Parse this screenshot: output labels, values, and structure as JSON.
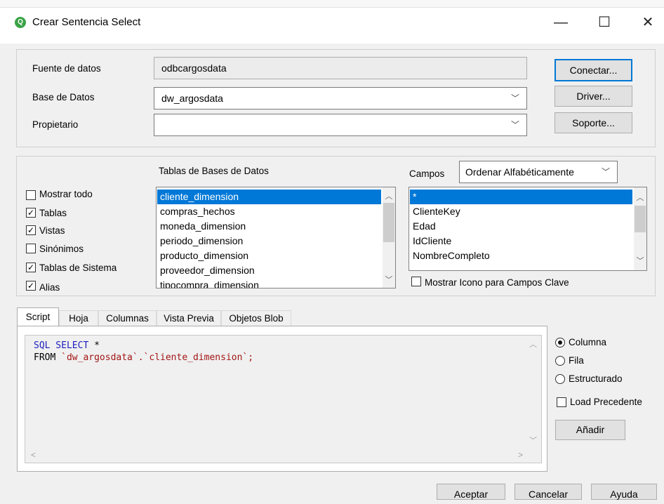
{
  "window": {
    "title": "Crear Sentencia Select",
    "app_badge": "Q",
    "min": "—",
    "max": "☐",
    "close": "✕"
  },
  "connection": {
    "fuente_label": "Fuente de datos",
    "fuente_value": "odbcargosdata",
    "base_label": "Base de Datos",
    "base_value": "dw_argosdata",
    "propietario_label": "Propietario",
    "propietario_value": "",
    "conectar": "Conectar...",
    "driver": "Driver...",
    "soporte": "Soporte..."
  },
  "options": {
    "mostrar_todo": "Mostrar todo",
    "tablas": "Tablas",
    "vistas": "Vistas",
    "sinonimos": "Sinónimos",
    "tablas_sistema": "Tablas de Sistema",
    "alias": "Alias",
    "checked": {
      "mostrar_todo": false,
      "tablas": true,
      "vistas": true,
      "sinonimos": false,
      "tablas_sistema": true,
      "alias": true
    }
  },
  "tables": {
    "header": "Tablas de Bases de Datos",
    "items": [
      "cliente_dimension",
      "compras_hechos",
      "moneda_dimension",
      "periodo_dimension",
      "producto_dimension",
      "proveedor_dimension",
      "tipocompra_dimension"
    ],
    "selected": 0
  },
  "fields": {
    "header": "Campos",
    "sort_value": "Ordenar Alfabéticamente",
    "items": [
      "*",
      "ClienteKey",
      "Edad",
      "IdCliente",
      "NombreCompleto"
    ],
    "selected": 0,
    "mostrar_icono": "Mostrar Icono para Campos Clave"
  },
  "tabs": [
    "Script",
    "Hoja",
    "Columnas",
    "Vista Previa",
    "Objetos Blob"
  ],
  "script": {
    "line1_keyword": "SQL SELECT",
    "line1_rest": " *",
    "line2_keyword": "FROM",
    "line2_value": "`dw_argosdata`.`cliente_dimension`;"
  },
  "format": {
    "columna": "Columna",
    "fila": "Fila",
    "estructurado": "Estructurado",
    "selected": "columna",
    "load_precedente": "Load Precedente",
    "anadir": "Añadir"
  },
  "footer": {
    "aceptar": "Aceptar",
    "cancelar": "Cancelar",
    "ayuda": "Ayuda"
  },
  "colors": {
    "accent": "#0078d7",
    "sql_keyword": "#1d1dbf",
    "sql_string": "#a31515",
    "qlik_green": "#3aa346"
  }
}
